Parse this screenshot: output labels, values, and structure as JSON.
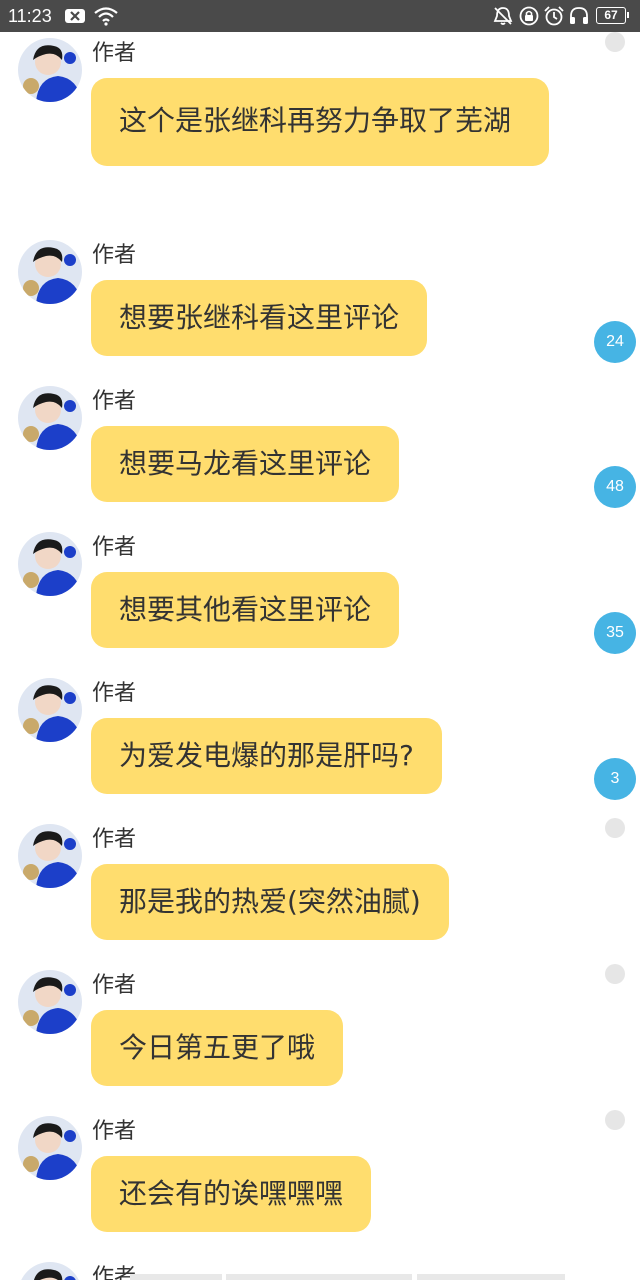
{
  "status_bar": {
    "time": "11:23",
    "battery": "67",
    "icons": [
      "close-box-icon",
      "wifi-icon",
      "mute-bell-icon",
      "lock-rotation-icon",
      "alarm-icon",
      "headphones-icon"
    ]
  },
  "messages": [
    {
      "author": "作者",
      "text": "这个是张继科再努力争取了芜湖",
      "indicator": "dot"
    },
    {
      "author": "作者",
      "text": "想要张继科看这里评论",
      "badge": "24"
    },
    {
      "author": "作者",
      "text": "想要马龙看这里评论",
      "badge": "48"
    },
    {
      "author": "作者",
      "text": "想要其他看这里评论",
      "badge": "35"
    },
    {
      "author": "作者",
      "text": "为爱发电爆的那是肝吗?",
      "badge": "3"
    },
    {
      "author": "作者",
      "text": "那是我的热爱(突然油腻)",
      "indicator": "dot"
    },
    {
      "author": "作者",
      "text": "今日第五更了哦",
      "indicator": "dot"
    },
    {
      "author": "作者",
      "text": "还会有的诶嘿嘿嘿",
      "indicator": "dot"
    },
    {
      "author": "作者"
    }
  ],
  "colors": {
    "status_bar": "#4a4a4a",
    "bubble": "#ffdd6e",
    "badge": "#46b4e4",
    "dot": "#e6e6e6",
    "text": "#333333"
  }
}
